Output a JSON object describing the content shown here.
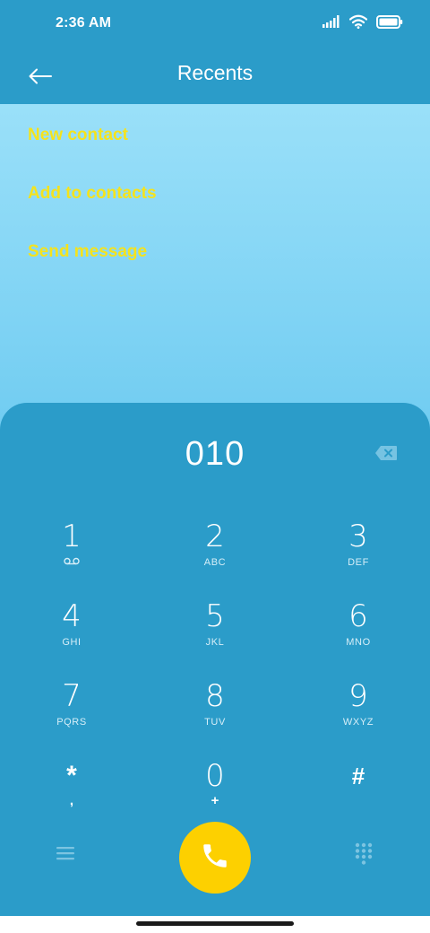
{
  "status_bar": {
    "time": "2:36 AM"
  },
  "header": {
    "title": "Recents"
  },
  "actions": [
    {
      "label": "New contact"
    },
    {
      "label": "Add to contacts"
    },
    {
      "label": "Send message"
    }
  ],
  "dialer": {
    "number": "010",
    "keys": [
      {
        "digit": "1",
        "letters": ""
      },
      {
        "digit": "2",
        "letters": "ABC"
      },
      {
        "digit": "3",
        "letters": "DEF"
      },
      {
        "digit": "4",
        "letters": "GHI"
      },
      {
        "digit": "5",
        "letters": "JKL"
      },
      {
        "digit": "6",
        "letters": "MNO"
      },
      {
        "digit": "7",
        "letters": "PQRS"
      },
      {
        "digit": "8",
        "letters": "TUV"
      },
      {
        "digit": "9",
        "letters": "WXYZ"
      },
      {
        "digit": "*",
        "letters": ","
      },
      {
        "digit": "0",
        "letters": "+"
      },
      {
        "digit": "#",
        "letters": ""
      }
    ]
  },
  "icons": {
    "back": "arrow-left-icon",
    "backspace": "backspace-icon",
    "voicemail": "voicemail-icon",
    "menu": "menu-icon",
    "call": "phone-icon",
    "keypad": "dialpad-icon",
    "signal": "signal-icon",
    "wifi": "wifi-icon",
    "battery": "battery-icon"
  },
  "colors": {
    "primary": "#2b9cc9",
    "accent_text": "#f5e31c",
    "call_button": "#fdd000"
  }
}
